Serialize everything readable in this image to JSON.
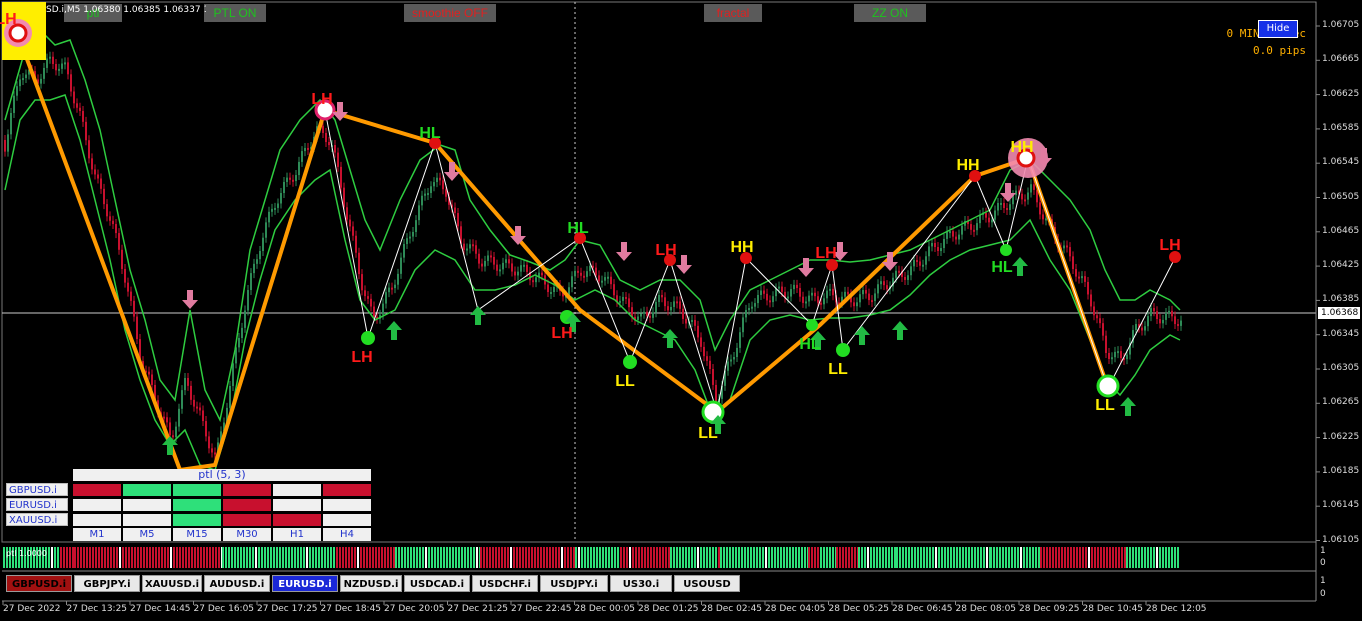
{
  "window": {
    "symbol_header": "SD.i,M5 1.06380 1.06385 1.06337 1.0",
    "current_price": "1.06368"
  },
  "toggles": [
    {
      "label": "ptl",
      "color": "#1ec21e"
    },
    {
      "label": "PTL ON",
      "color": "#1ec21e"
    },
    {
      "label": "smoothie OFF",
      "color": "#e02020"
    },
    {
      "label": "fractal",
      "color": "#e02020"
    },
    {
      "label": "ZZ ON",
      "color": "#1ec21e"
    }
  ],
  "hud": {
    "timer": "0 MIN 36 Sec",
    "pips": "0.0 pips",
    "hide_label": "Hide"
  },
  "price_axis": [
    "1.06705",
    "1.06665",
    "1.06625",
    "1.06585",
    "1.06545",
    "1.06505",
    "1.06465",
    "1.06425",
    "1.06385",
    "1.06345",
    "1.06305",
    "1.06265",
    "1.06225",
    "1.06185",
    "1.06145",
    "1.06105"
  ],
  "time_axis": [
    "27 Dec 2022",
    "27 Dec 13:25",
    "27 Dec 14:45",
    "27 Dec 16:05",
    "27 Dec 17:25",
    "27 Dec 18:45",
    "27 Dec 20:05",
    "27 Dec 21:25",
    "27 Dec 22:45",
    "28 Dec 00:05",
    "28 Dec 01:25",
    "28 Dec 02:45",
    "28 Dec 04:05",
    "28 Dec 05:25",
    "28 Dec 06:45",
    "28 Dec 08:05",
    "28 Dec 09:25",
    "28 Dec 10:45",
    "28 Dec 12:05"
  ],
  "swing_labels": [
    {
      "text": "LH",
      "color": "#ff1a1a"
    },
    {
      "text": "LH",
      "color": "#ff1a1a"
    },
    {
      "text": "HL",
      "color": "#22dd22"
    },
    {
      "text": "LH",
      "color": "#ff1a1a"
    },
    {
      "text": "HL",
      "color": "#22dd22"
    },
    {
      "text": "LH",
      "color": "#ff1a1a"
    },
    {
      "text": "LL",
      "color": "#ffee00"
    },
    {
      "text": "LH",
      "color": "#ff1a1a"
    },
    {
      "text": "HH",
      "color": "#ffee00"
    },
    {
      "text": "LL",
      "color": "#ffee00"
    },
    {
      "text": "LH",
      "color": "#ff1a1a"
    },
    {
      "text": "HL",
      "color": "#22dd22"
    },
    {
      "text": "LL",
      "color": "#ffee00"
    },
    {
      "text": "HH",
      "color": "#ffee00"
    },
    {
      "text": "HH",
      "color": "#ffee00"
    },
    {
      "text": "HL",
      "color": "#22dd22"
    },
    {
      "text": "LL",
      "color": "#ffee00"
    },
    {
      "text": "LH",
      "color": "#ff1a1a"
    }
  ],
  "ptl_table": {
    "title": "ptl (5, 3)",
    "symbols": [
      "GBPUSD.i",
      "EURUSD.i",
      "XAUUSD.i"
    ],
    "timeframes": [
      "M1",
      "M5",
      "M15",
      "M30",
      "H1",
      "H4"
    ],
    "cells": [
      [
        "red",
        "green",
        "green",
        "red",
        "white",
        "red"
      ],
      [
        "white",
        "white",
        "green",
        "red",
        "white",
        "white"
      ],
      [
        "white",
        "white",
        "green",
        "red",
        "red",
        "white"
      ]
    ],
    "colors": {
      "red": "#c8102e",
      "green": "#2ee07a",
      "white": "#f0f0f0"
    }
  },
  "subwindow1": {
    "label": "ptl 1.0000",
    "axis_top": "1",
    "axis_bottom": "0"
  },
  "subwindow2": {
    "axis_top": "1",
    "axis_bottom": "0"
  },
  "symbol_buttons": [
    {
      "label": "GBPUSD.i",
      "state": "bearish"
    },
    {
      "label": "GBPJPY.i",
      "state": "normal"
    },
    {
      "label": "XAUUSD.i",
      "state": "normal"
    },
    {
      "label": "AUDUSD.i",
      "state": "normal"
    },
    {
      "label": "EURUSD.i",
      "state": "active"
    },
    {
      "label": "NZDUSD.i",
      "state": "normal"
    },
    {
      "label": "USDCAD.i",
      "state": "normal"
    },
    {
      "label": "USDCHF.i",
      "state": "normal"
    },
    {
      "label": "USDJPY.i",
      "state": "normal"
    },
    {
      "label": "US30.i",
      "state": "normal"
    },
    {
      "label": "USOUSD",
      "state": "normal"
    }
  ]
}
